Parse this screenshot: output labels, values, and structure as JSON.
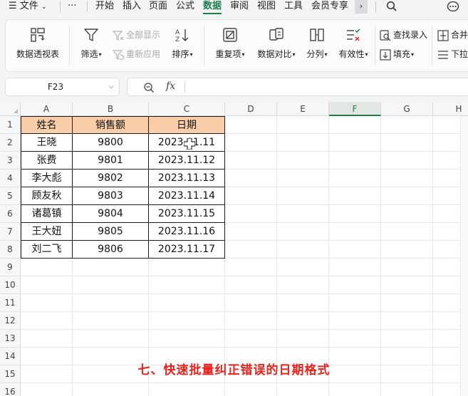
{
  "menubar": {
    "file": "文件",
    "more": "···",
    "tabs": [
      "开始",
      "插入",
      "页面",
      "公式",
      "数据",
      "审阅",
      "视图",
      "工具",
      "会员专享"
    ],
    "active_tab": "数据",
    "more_tabs_glyph": "›"
  },
  "ribbon": {
    "pivot": "数据透视表",
    "filter": "筛选",
    "show_all": "全部显示",
    "reapply": "重新应用",
    "sort": "排序",
    "duplicates": "重复项",
    "compare": "数据对比",
    "split": "分列",
    "validity": "有效性",
    "find_entry": "查找录入",
    "fill": "填充",
    "merge": "合并",
    "dropdown": "下拉"
  },
  "formula_bar": {
    "name_box": "F23",
    "fx_label": "fx",
    "formula": ""
  },
  "sheet": {
    "columns": [
      "A",
      "B",
      "C",
      "D",
      "E",
      "F",
      "G",
      "H"
    ],
    "selected_column": "F",
    "rows": [
      "1",
      "2",
      "3",
      "4",
      "5",
      "6",
      "7",
      "8",
      "9",
      "10",
      "11",
      "12",
      "13",
      "14",
      "15",
      "16"
    ],
    "table": {
      "header": [
        "姓名",
        "销售额",
        "日期"
      ],
      "rows": [
        [
          "王晓",
          "9800",
          "2023.11.11"
        ],
        [
          "张费",
          "9801",
          "2023.11.12"
        ],
        [
          "李大彪",
          "9802",
          "2023.11.13"
        ],
        [
          "顾友秋",
          "9803",
          "2023.11.14"
        ],
        [
          "诸葛镇",
          "9804",
          "2023.11.15"
        ],
        [
          "王大妞",
          "9805",
          "2023.11.16"
        ],
        [
          "刘二飞",
          "9806",
          "2023.11.17"
        ]
      ]
    },
    "header_fill": "#f9cda8"
  },
  "caption": "七、快速批量纠正错误的日期格式",
  "colors": {
    "accent": "#1a7f4a",
    "caption": "#e8231c"
  }
}
